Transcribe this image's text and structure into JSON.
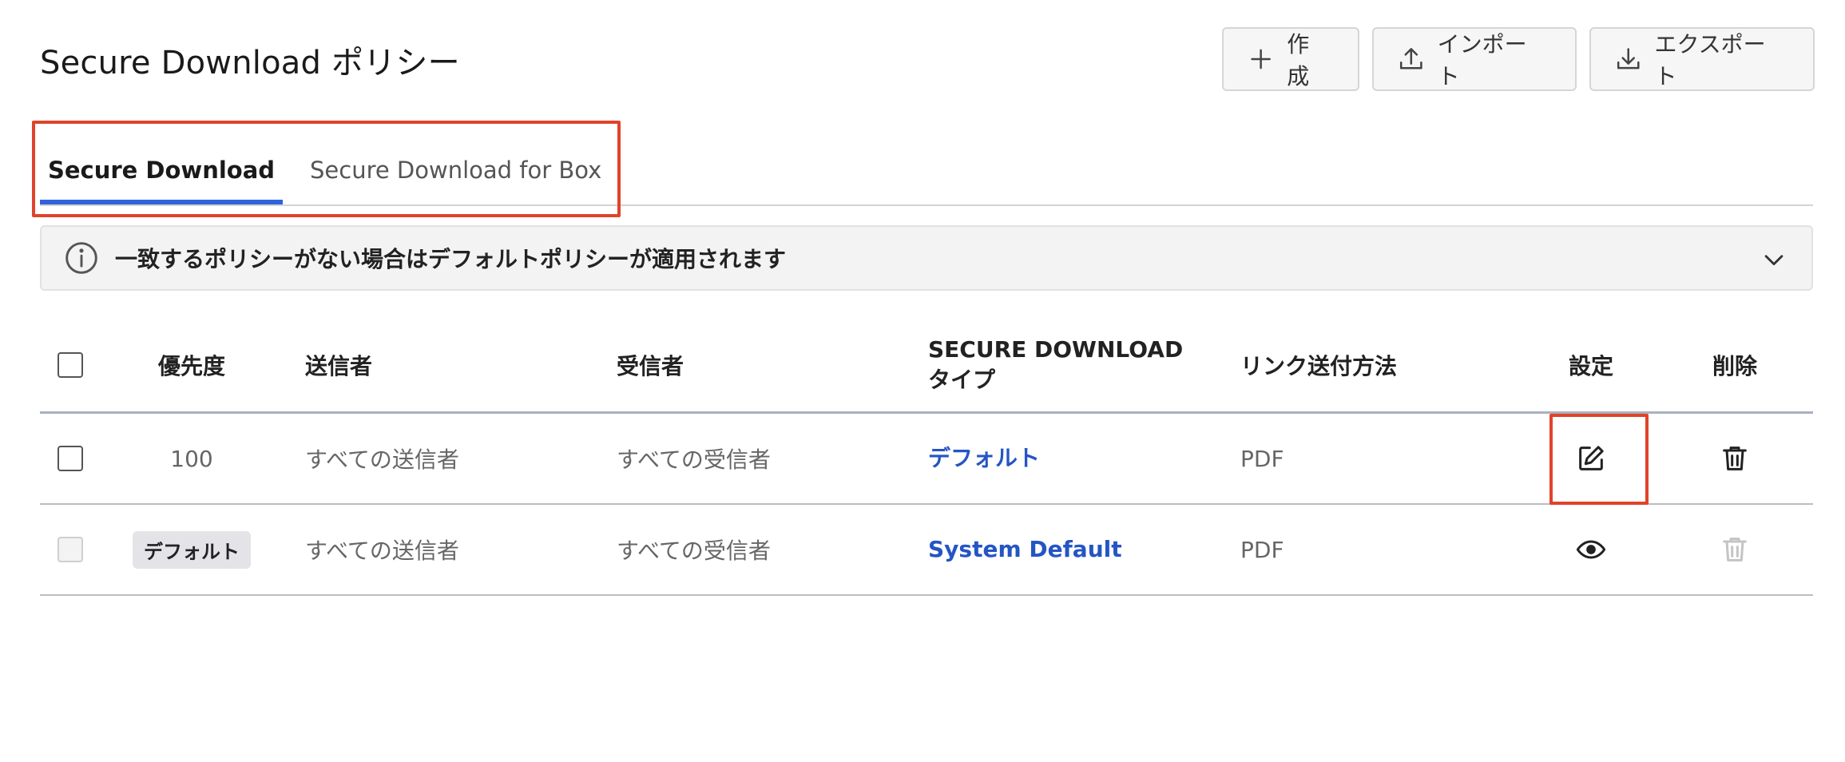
{
  "page": {
    "title": "Secure Download ポリシー"
  },
  "toolbar": {
    "create_label": "作成",
    "import_label": "インポート",
    "export_label": "エクスポート"
  },
  "tabs": [
    {
      "label": "Secure Download",
      "active": true
    },
    {
      "label": "Secure Download for Box",
      "active": false
    }
  ],
  "banner": {
    "text": "一致するポリシーがない場合はデフォルトポリシーが適用されます"
  },
  "table": {
    "columns": {
      "priority": "優先度",
      "sender": "送信者",
      "recipient": "受信者",
      "type": "SECURE DOWNLOAD タイプ",
      "link_method": "リンク送付方法",
      "settings": "設定",
      "delete": "削除"
    },
    "rows": [
      {
        "priority": "100",
        "sender": "すべての送信者",
        "recipient": "すべての受信者",
        "type": "デフォルト",
        "link_method": "PDF",
        "settings_action": "edit",
        "deletable": true
      },
      {
        "priority": "デフォルト",
        "sender": "すべての送信者",
        "recipient": "すべての受信者",
        "type": "System Default",
        "link_method": "PDF",
        "settings_action": "view",
        "deletable": false
      }
    ]
  },
  "icons": {
    "create": "plus-icon",
    "import": "upload-icon",
    "export": "download-icon",
    "info": "info-icon",
    "expand": "chevron-down-icon",
    "edit": "edit-icon",
    "view": "eye-icon",
    "delete": "trash-icon"
  },
  "colors": {
    "accent": "#2e63dd",
    "link": "#2455c3",
    "annotation": "#e0432b"
  }
}
